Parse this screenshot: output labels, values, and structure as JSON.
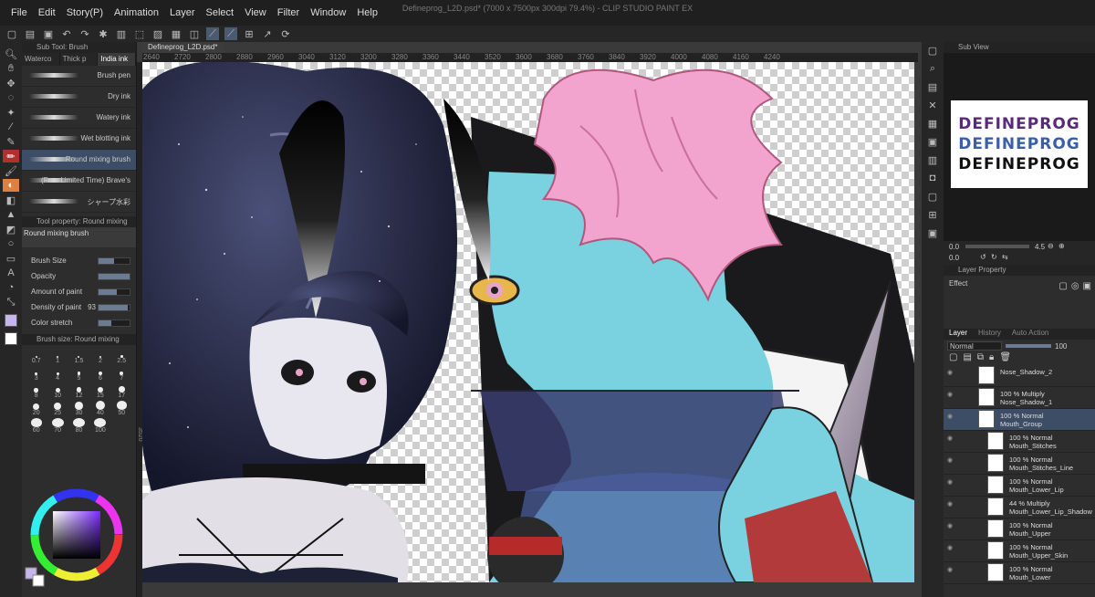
{
  "app": {
    "title": "Defineprog_L2D.psd* (7000 x 7500px 300dpi 79.4%) - CLIP STUDIO PAINT EX"
  },
  "menu": [
    "File",
    "Edit",
    "Story(P)",
    "Animation",
    "Layer",
    "Select",
    "View",
    "Filter",
    "Window",
    "Help"
  ],
  "left": {
    "subtool_header": "Sub Tool: Brush",
    "subtool_tabs": [
      "Waterco",
      "Thick p",
      "India ink"
    ],
    "brushes": [
      {
        "name": "Brush pen"
      },
      {
        "name": "Dry ink"
      },
      {
        "name": "Watery ink"
      },
      {
        "name": "Wet blotting ink"
      },
      {
        "name": "Round mixing brush",
        "active": true
      },
      {
        "name": "(Free Limited Time) Brave's"
      },
      {
        "name": "シャープ水彩"
      }
    ],
    "tool_property_header": "Tool property: Round mixing",
    "tool_property_name": "Round mixing brush",
    "props": [
      {
        "label": "Brush Size",
        "value": "",
        "fill": 0.5
      },
      {
        "label": "Opacity",
        "value": "",
        "fill": 1.0
      },
      {
        "label": "Amount of paint",
        "value": "",
        "fill": 0.6
      },
      {
        "label": "Density of paint",
        "value": "93",
        "fill": 0.93
      },
      {
        "label": "Color stretch",
        "value": "",
        "fill": 0.4
      }
    ],
    "brush_size_header": "Brush size: Round mixing",
    "sizes": [
      "0.7",
      "1",
      "1.5",
      "2",
      "2.5",
      "3",
      "4",
      "5",
      "6",
      "7",
      "8",
      "10",
      "12",
      "15",
      "17",
      "20",
      "25",
      "30",
      "40",
      "50",
      "60",
      "70",
      "80",
      "100"
    ]
  },
  "canvas": {
    "doc_tab": "Defineprog_L2D.psd*",
    "ruler_labels": [
      "2640",
      "2720",
      "2800",
      "2880",
      "2960",
      "3040",
      "3120",
      "3200",
      "3280",
      "3360",
      "3440",
      "3520",
      "3600",
      "3680",
      "3760",
      "3840",
      "3920",
      "4000",
      "4080",
      "4160",
      "4240"
    ],
    "left_ruler_label": "3520"
  },
  "right": {
    "subview_header": "Sub View",
    "logo_lines": [
      {
        "text": "DEFINEPROG",
        "color": "#5a2a7a"
      },
      {
        "text": "DEFINEPROG",
        "color": "#3b5ea8"
      },
      {
        "text": "DEFINEPROG",
        "color": "#111111"
      }
    ],
    "zoom_value": "4.5",
    "nav_values": [
      "0.0",
      "0.0"
    ],
    "layer_property_header": "Layer Property",
    "effect_label": "Effect",
    "layer_tabs": [
      "Layer",
      "History",
      "Auto Action"
    ],
    "blend_mode": "Normal",
    "opacity_value": "100",
    "layers": [
      {
        "line1": "Nose_Shadow_2",
        "line2": "",
        "sub": false,
        "group": false
      },
      {
        "line1": "100 % Multiply",
        "line2": "Nose_Shadow_1",
        "sub": false,
        "group": false
      },
      {
        "line1": "100 % Normal",
        "line2": "Mouth_Group",
        "sub": false,
        "group": true
      },
      {
        "line1": "100 % Normal",
        "line2": "Mouth_Stitches",
        "sub": true,
        "group": false
      },
      {
        "line1": "100 % Normal",
        "line2": "Mouth_Stitches_Line",
        "sub": true,
        "group": false
      },
      {
        "line1": "100 % Normal",
        "line2": "Mouth_Lower_Lip",
        "sub": true,
        "group": false
      },
      {
        "line1": "44 % Multiply",
        "line2": "Mouth_Lower_Lip_Shadow",
        "sub": true,
        "group": false
      },
      {
        "line1": "100 % Normal",
        "line2": "Mouth_Upper",
        "sub": true,
        "group": false
      },
      {
        "line1": "100 % Normal",
        "line2": "Mouth_Upper_Skin",
        "sub": true,
        "group": false
      },
      {
        "line1": "100 % Normal",
        "line2": "Mouth_Lower",
        "sub": true,
        "group": false
      }
    ]
  },
  "colors": {
    "accent": "#3d4d66",
    "main_color": "#c7b6ee",
    "sub_color": "#ffffff"
  }
}
